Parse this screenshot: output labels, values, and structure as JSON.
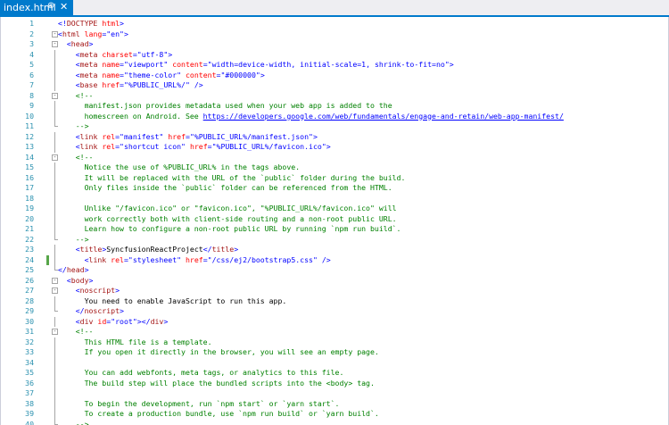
{
  "tab": {
    "filename": "index.html",
    "pin_icon": "pin-icon",
    "close_icon": "close-icon",
    "pin_glyph": "⊕",
    "close_glyph": "✕"
  },
  "colors": {
    "tag": "#a31515",
    "delim": "#0000ff",
    "attr": "#ff0000",
    "value": "#0000ff",
    "comment": "#008000",
    "line_number": "#2b91af",
    "accent": "#007acc",
    "change_marker": "#57a64a"
  },
  "editor": {
    "lines": [
      {
        "n": "1",
        "fold": "",
        "segs": [
          [
            "d",
            "<!"
          ],
          [
            "t",
            "DOCTYPE"
          ],
          [
            "x",
            " "
          ],
          [
            "a",
            "html"
          ],
          [
            "d",
            ">"
          ]
        ]
      },
      {
        "n": "2",
        "fold": "-",
        "segs": [
          [
            "d",
            "<"
          ],
          [
            "t",
            "html"
          ],
          [
            "x",
            " "
          ],
          [
            "a",
            "lang"
          ],
          [
            "d",
            "="
          ],
          [
            "v",
            "\"en\""
          ],
          [
            "d",
            ">"
          ]
        ]
      },
      {
        "n": "3",
        "fold": "-",
        "segs": [
          [
            "x",
            "  "
          ],
          [
            "d",
            "<"
          ],
          [
            "t",
            "head"
          ],
          [
            "d",
            ">"
          ]
        ]
      },
      {
        "n": "4",
        "fold": "",
        "segs": [
          [
            "x",
            "    "
          ],
          [
            "d",
            "<"
          ],
          [
            "t",
            "meta"
          ],
          [
            "x",
            " "
          ],
          [
            "a",
            "charset"
          ],
          [
            "d",
            "="
          ],
          [
            "v",
            "\"utf-8\""
          ],
          [
            "d",
            ">"
          ]
        ]
      },
      {
        "n": "5",
        "fold": "",
        "segs": [
          [
            "x",
            "    "
          ],
          [
            "d",
            "<"
          ],
          [
            "t",
            "meta"
          ],
          [
            "x",
            " "
          ],
          [
            "a",
            "name"
          ],
          [
            "d",
            "="
          ],
          [
            "v",
            "\"viewport\""
          ],
          [
            "x",
            " "
          ],
          [
            "a",
            "content"
          ],
          [
            "d",
            "="
          ],
          [
            "v",
            "\"width=device-width, initial-scale=1, shrink-to-fit=no\""
          ],
          [
            "d",
            ">"
          ]
        ]
      },
      {
        "n": "6",
        "fold": "",
        "segs": [
          [
            "x",
            "    "
          ],
          [
            "d",
            "<"
          ],
          [
            "t",
            "meta"
          ],
          [
            "x",
            " "
          ],
          [
            "a",
            "name"
          ],
          [
            "d",
            "="
          ],
          [
            "v",
            "\"theme-color\""
          ],
          [
            "x",
            " "
          ],
          [
            "a",
            "content"
          ],
          [
            "d",
            "="
          ],
          [
            "v",
            "\"#000000\""
          ],
          [
            "d",
            ">"
          ]
        ]
      },
      {
        "n": "7",
        "fold": "",
        "segs": [
          [
            "x",
            "    "
          ],
          [
            "d",
            "<"
          ],
          [
            "t",
            "base"
          ],
          [
            "x",
            " "
          ],
          [
            "a",
            "href"
          ],
          [
            "d",
            "="
          ],
          [
            "v",
            "\"%PUBLIC_URL%/\""
          ],
          [
            "x",
            " "
          ],
          [
            "d",
            "/>"
          ]
        ]
      },
      {
        "n": "8",
        "fold": "-",
        "segs": [
          [
            "x",
            "    "
          ],
          [
            "c",
            "<!--"
          ]
        ]
      },
      {
        "n": "9",
        "fold": "",
        "segs": [
          [
            "c",
            "      manifest.json provides metadata used when your web app is added to the"
          ]
        ]
      },
      {
        "n": "10",
        "fold": "",
        "segs": [
          [
            "c",
            "      homescreen on Android. See "
          ],
          [
            "u",
            "https://developers.google.com/web/fundamentals/engage-and-retain/web-app-manifest/"
          ]
        ]
      },
      {
        "n": "11",
        "fold": "",
        "segs": [
          [
            "c",
            "    -->"
          ]
        ]
      },
      {
        "n": "12",
        "fold": "",
        "segs": [
          [
            "x",
            "    "
          ],
          [
            "d",
            "<"
          ],
          [
            "t",
            "link"
          ],
          [
            "x",
            " "
          ],
          [
            "a",
            "rel"
          ],
          [
            "d",
            "="
          ],
          [
            "v",
            "\"manifest\""
          ],
          [
            "x",
            " "
          ],
          [
            "a",
            "href"
          ],
          [
            "d",
            "="
          ],
          [
            "v",
            "\"%PUBLIC_URL%/manifest.json\""
          ],
          [
            "d",
            ">"
          ]
        ]
      },
      {
        "n": "13",
        "fold": "",
        "segs": [
          [
            "x",
            "    "
          ],
          [
            "d",
            "<"
          ],
          [
            "t",
            "link"
          ],
          [
            "x",
            " "
          ],
          [
            "a",
            "rel"
          ],
          [
            "d",
            "="
          ],
          [
            "v",
            "\"shortcut icon\""
          ],
          [
            "x",
            " "
          ],
          [
            "a",
            "href"
          ],
          [
            "d",
            "="
          ],
          [
            "v",
            "\"%PUBLIC_URL%/favicon.ico\""
          ],
          [
            "d",
            ">"
          ]
        ]
      },
      {
        "n": "14",
        "fold": "-",
        "segs": [
          [
            "x",
            "    "
          ],
          [
            "c",
            "<!--"
          ]
        ]
      },
      {
        "n": "15",
        "fold": "",
        "segs": [
          [
            "c",
            "      Notice the use of %PUBLIC_URL% in the tags above."
          ]
        ]
      },
      {
        "n": "16",
        "fold": "",
        "segs": [
          [
            "c",
            "      It will be replaced with the URL of the `public` folder during the build."
          ]
        ]
      },
      {
        "n": "17",
        "fold": "",
        "segs": [
          [
            "c",
            "      Only files inside the `public` folder can be referenced from the HTML."
          ]
        ]
      },
      {
        "n": "18",
        "fold": "",
        "segs": [
          [
            "c",
            ""
          ]
        ]
      },
      {
        "n": "19",
        "fold": "",
        "segs": [
          [
            "c",
            "      Unlike \"/favicon.ico\" or \"favicon.ico\", \"%PUBLIC_URL%/favicon.ico\" will"
          ]
        ]
      },
      {
        "n": "20",
        "fold": "",
        "segs": [
          [
            "c",
            "      work correctly both with client-side routing and a non-root public URL."
          ]
        ]
      },
      {
        "n": "21",
        "fold": "",
        "segs": [
          [
            "c",
            "      Learn how to configure a non-root public URL by running `npm run build`."
          ]
        ]
      },
      {
        "n": "22",
        "fold": "",
        "segs": [
          [
            "c",
            "    -->"
          ]
        ]
      },
      {
        "n": "23",
        "fold": "",
        "segs": [
          [
            "x",
            "    "
          ],
          [
            "d",
            "<"
          ],
          [
            "t",
            "title"
          ],
          [
            "d",
            ">"
          ],
          [
            "x",
            "SyncfusionReactProject"
          ],
          [
            "d",
            "</"
          ],
          [
            "t",
            "title"
          ],
          [
            "d",
            ">"
          ]
        ]
      },
      {
        "n": "24",
        "fold": "",
        "mark": true,
        "segs": [
          [
            "x",
            "      "
          ],
          [
            "d",
            "<"
          ],
          [
            "t",
            "link"
          ],
          [
            "x",
            " "
          ],
          [
            "a",
            "rel"
          ],
          [
            "d",
            "="
          ],
          [
            "v",
            "\"stylesheet\""
          ],
          [
            "x",
            " "
          ],
          [
            "a",
            "href"
          ],
          [
            "d",
            "="
          ],
          [
            "v",
            "\"/css/ej2/bootstrap5.css\""
          ],
          [
            "x",
            " "
          ],
          [
            "d",
            "/>"
          ]
        ]
      },
      {
        "n": "25",
        "fold": "",
        "segs": [
          [
            "d",
            "</"
          ],
          [
            "t",
            "head"
          ],
          [
            "d",
            ">"
          ]
        ]
      },
      {
        "n": "26",
        "fold": "-",
        "segs": [
          [
            "x",
            "  "
          ],
          [
            "d",
            "<"
          ],
          [
            "t",
            "body"
          ],
          [
            "d",
            ">"
          ]
        ]
      },
      {
        "n": "27",
        "fold": "-",
        "segs": [
          [
            "x",
            "    "
          ],
          [
            "d",
            "<"
          ],
          [
            "t",
            "noscript"
          ],
          [
            "d",
            ">"
          ]
        ]
      },
      {
        "n": "28",
        "fold": "",
        "segs": [
          [
            "x",
            "      You need to enable JavaScript to run this app."
          ]
        ]
      },
      {
        "n": "29",
        "fold": "",
        "segs": [
          [
            "x",
            "    "
          ],
          [
            "d",
            "</"
          ],
          [
            "t",
            "noscript"
          ],
          [
            "d",
            ">"
          ]
        ]
      },
      {
        "n": "30",
        "fold": "",
        "segs": [
          [
            "x",
            "    "
          ],
          [
            "d",
            "<"
          ],
          [
            "t",
            "div"
          ],
          [
            "x",
            " "
          ],
          [
            "a",
            "id"
          ],
          [
            "d",
            "="
          ],
          [
            "v",
            "\"root\""
          ],
          [
            "d",
            "></"
          ],
          [
            "t",
            "div"
          ],
          [
            "d",
            ">"
          ]
        ]
      },
      {
        "n": "31",
        "fold": "-",
        "segs": [
          [
            "x",
            "    "
          ],
          [
            "c",
            "<!--"
          ]
        ]
      },
      {
        "n": "32",
        "fold": "",
        "segs": [
          [
            "c",
            "      This HTML file is a template."
          ]
        ]
      },
      {
        "n": "33",
        "fold": "",
        "segs": [
          [
            "c",
            "      If you open it directly in the browser, you will see an empty page."
          ]
        ]
      },
      {
        "n": "34",
        "fold": "",
        "segs": [
          [
            "c",
            ""
          ]
        ]
      },
      {
        "n": "35",
        "fold": "",
        "segs": [
          [
            "c",
            "      You can add webfonts, meta tags, or analytics to this file."
          ]
        ]
      },
      {
        "n": "36",
        "fold": "",
        "segs": [
          [
            "c",
            "      The build step will place the bundled scripts into the <body> tag."
          ]
        ]
      },
      {
        "n": "37",
        "fold": "",
        "segs": [
          [
            "c",
            ""
          ]
        ]
      },
      {
        "n": "38",
        "fold": "",
        "segs": [
          [
            "c",
            "      To begin the development, run `npm start` or `yarn start`."
          ]
        ]
      },
      {
        "n": "39",
        "fold": "",
        "segs": [
          [
            "c",
            "      To create a production bundle, use `npm run build` or `yarn build`."
          ]
        ]
      },
      {
        "n": "40",
        "fold": "",
        "segs": [
          [
            "c",
            "    -->"
          ]
        ]
      }
    ]
  }
}
